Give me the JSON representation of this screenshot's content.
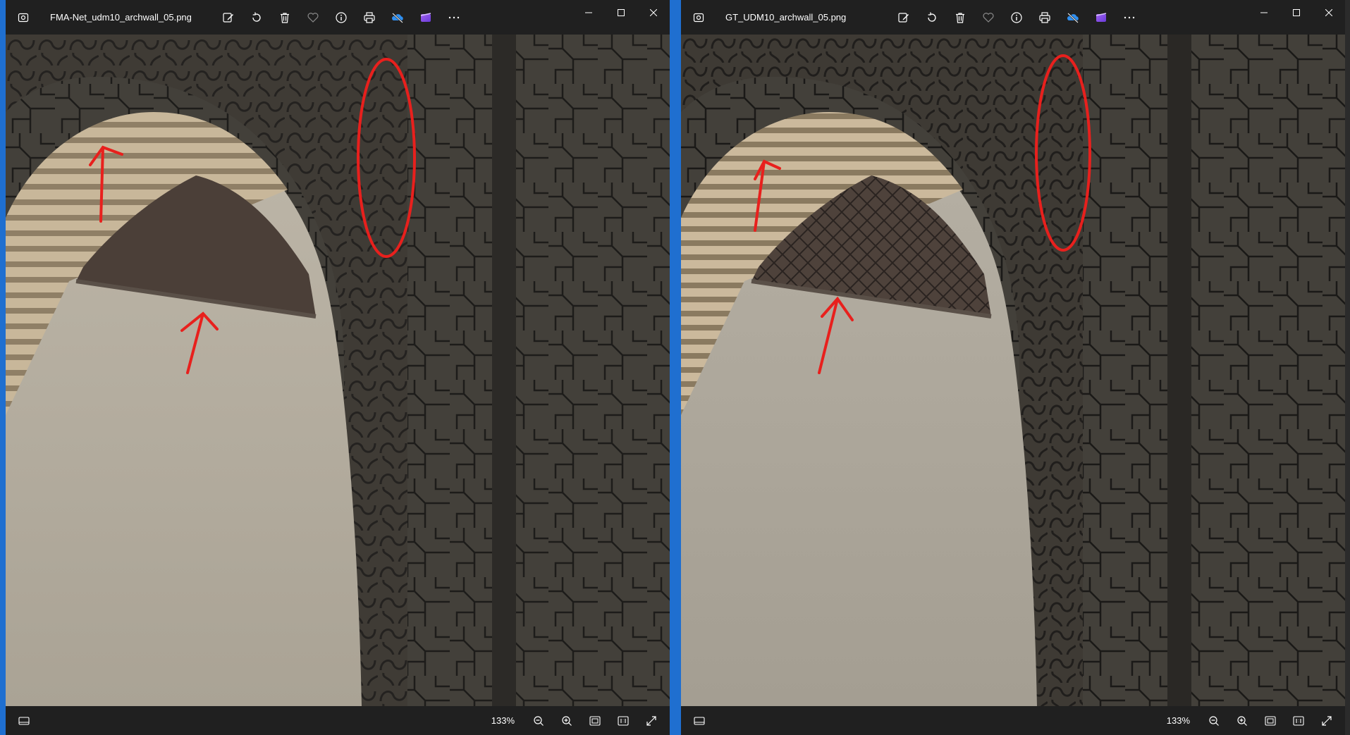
{
  "windows": [
    {
      "title": "FMA-Net_udm10_archwall_05.png",
      "zoom": "133%",
      "toolbar_icons": [
        "edit-image-icon",
        "rotate-icon",
        "delete-icon",
        "favorite-heart-icon",
        "info-icon",
        "print-icon",
        "onedrive-icon",
        "clipchamp-icon",
        "more-options-icon"
      ]
    },
    {
      "title": "GT_UDM10_archwall_05.png",
      "zoom": "133%",
      "toolbar_icons": [
        "edit-image-icon",
        "rotate-icon",
        "delete-icon",
        "favorite-heart-icon",
        "info-icon",
        "print-icon",
        "onedrive-icon",
        "clipchamp-icon",
        "more-options-icon"
      ]
    }
  ],
  "colors": {
    "accent_border": "#1f6fd0",
    "annotation": "#e8201d",
    "titlebar": "#202020"
  }
}
